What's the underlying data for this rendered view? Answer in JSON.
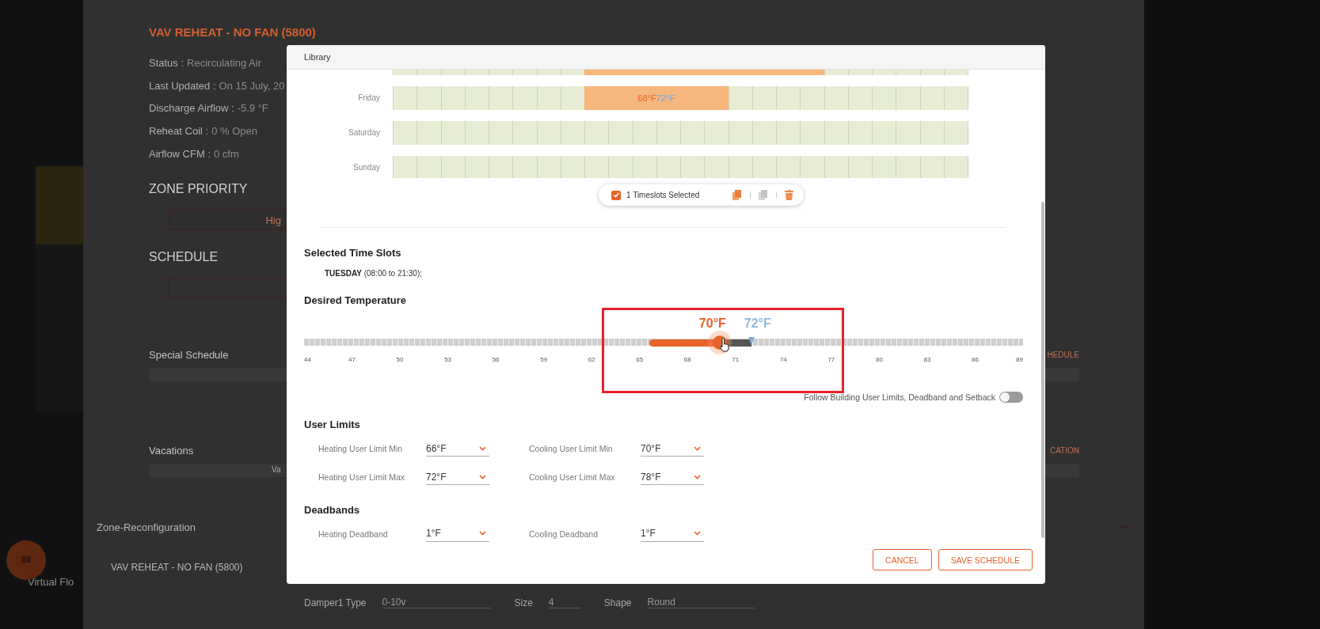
{
  "background_page": {
    "title": "VAV REHEAT - NO FAN (5800)",
    "status": [
      {
        "label": "Status :",
        "value": "Recirculating Air"
      },
      {
        "label": "Last Updated :",
        "value": "On 15 July, 20"
      },
      {
        "label": "Discharge Airflow :",
        "value": "-5.9 °F"
      },
      {
        "label": "Reheat Coil :",
        "value": "0 % Open"
      },
      {
        "label": "Airflow CFM :",
        "value": "0 cfm"
      }
    ],
    "zone_priority": {
      "heading": "ZONE PRIORITY",
      "button": "Hig"
    },
    "schedule": {
      "heading": "SCHEDULE"
    },
    "special_schedule": {
      "heading": "Special Schedule",
      "action": "HEDULE"
    },
    "vacations": {
      "heading": "Vacations",
      "bar_text": "Va",
      "action": "CATION"
    },
    "zone_reconfiguration": {
      "heading": "Zone-Reconfiguration",
      "subheading": "VAV REHEAT - NO FAN (5800)"
    },
    "damper": [
      {
        "label": "Damper1 Type",
        "value": "0-10v"
      },
      {
        "label": "Size",
        "value": "4"
      },
      {
        "label": "Shape",
        "value": "Round"
      }
    ],
    "sidebar_text": "Virtual Flo"
  },
  "modal": {
    "title": "Library",
    "calendar": [
      {
        "cells": [
          {
            "filled": false
          },
          {
            "filled": false
          },
          {
            "filled": false
          },
          {
            "filled": false
          },
          {
            "filled": false
          },
          {
            "filled": false
          },
          {
            "filled": false
          },
          {
            "filled": false
          },
          {
            "filled": true
          },
          {
            "filled": true
          },
          {
            "filled": true
          },
          {
            "filled": true
          },
          {
            "filled": true
          },
          {
            "filled": true
          },
          {
            "filled": true
          },
          {
            "filled": true
          },
          {
            "filled": true
          },
          {
            "filled": true
          },
          {
            "filled": false
          },
          {
            "filled": false
          },
          {
            "filled": false
          },
          {
            "filled": false
          },
          {
            "filled": false
          },
          {
            "filled": false
          }
        ]
      },
      {
        "day": "Friday",
        "heating": "68°F",
        "cooling": "72°F",
        "cells": [
          {
            "filled": false
          },
          {
            "filled": false
          },
          {
            "filled": false
          },
          {
            "filled": false
          },
          {
            "filled": false
          },
          {
            "filled": false
          },
          {
            "filled": false
          },
          {
            "filled": false
          },
          {
            "filled": true
          },
          {
            "filled": true
          },
          {
            "filled": true
          },
          {
            "filled": true
          },
          {
            "filled": true
          },
          {
            "filled": true
          },
          {
            "filled": false
          },
          {
            "filled": false
          },
          {
            "filled": false
          },
          {
            "filled": false
          },
          {
            "filled": false
          },
          {
            "filled": false
          },
          {
            "filled": false
          },
          {
            "filled": false
          },
          {
            "filled": false
          },
          {
            "filled": false
          }
        ]
      },
      {
        "day": "Saturday",
        "cells": [
          {
            "filled": false
          },
          {
            "filled": false
          },
          {
            "filled": false
          },
          {
            "filled": false
          },
          {
            "filled": false
          },
          {
            "filled": false
          },
          {
            "filled": false
          },
          {
            "filled": false
          },
          {
            "filled": false
          },
          {
            "filled": false
          },
          {
            "filled": false
          },
          {
            "filled": false
          },
          {
            "filled": false
          },
          {
            "filled": false
          },
          {
            "filled": false
          },
          {
            "filled": false
          },
          {
            "filled": false
          },
          {
            "filled": false
          },
          {
            "filled": false
          },
          {
            "filled": false
          },
          {
            "filled": false
          },
          {
            "filled": false
          },
          {
            "filled": false
          },
          {
            "filled": false
          }
        ]
      },
      {
        "day": "Sunday",
        "cells": [
          {
            "filled": false
          },
          {
            "filled": false
          },
          {
            "filled": false
          },
          {
            "filled": false
          },
          {
            "filled": false
          },
          {
            "filled": false
          },
          {
            "filled": false
          },
          {
            "filled": false
          },
          {
            "filled": false
          },
          {
            "filled": false
          },
          {
            "filled": false
          },
          {
            "filled": false
          },
          {
            "filled": false
          },
          {
            "filled": false
          },
          {
            "filled": false
          },
          {
            "filled": false
          },
          {
            "filled": false
          },
          {
            "filled": false
          },
          {
            "filled": false
          },
          {
            "filled": false
          },
          {
            "filled": false
          },
          {
            "filled": false
          },
          {
            "filled": false
          },
          {
            "filled": false
          }
        ]
      }
    ],
    "selection": {
      "checked": true,
      "label": "1 Timeslots Selected"
    },
    "selected_heading": "Selected Time Slots",
    "selected_slots": [
      {
        "day": "TUESDAY",
        "range": "(08:00 to 21:30);"
      }
    ],
    "desired_heading": "Desired Temperature",
    "slider": {
      "lower_limit": {
        "level": 0.48
      },
      "heating": {
        "reading": "70°F",
        "level": 0.578
      },
      "cooling": {
        "reading": "72°F",
        "level": 0.622
      },
      "scale": [
        "44",
        "47",
        "50",
        "53",
        "56",
        "59",
        "62",
        "65",
        "68",
        "71",
        "74",
        "77",
        "80",
        "83",
        "86",
        "89"
      ]
    },
    "follow_building": {
      "label": "Follow Building User Limits, Deadband and Setback",
      "on": false
    },
    "sections": [
      {
        "heading": "User Limits",
        "rows": [
          [
            {
              "label": "Heating User Limit Min",
              "value": "66°F"
            },
            {
              "label": "Cooling User Limit Min",
              "value": "70°F"
            }
          ],
          [
            {
              "label": "Heating User Limit Max",
              "value": "72°F"
            },
            {
              "label": "Cooling User Limit Max",
              "value": "78°F"
            }
          ]
        ]
      },
      {
        "heading": "Deadbands",
        "rows": [
          [
            {
              "label": "Heating Deadband",
              "value": "1°F"
            },
            {
              "label": "Cooling Deadband",
              "value": "1°F"
            }
          ]
        ]
      }
    ],
    "buttons": [
      "CANCEL",
      "SAVE SCHEDULE"
    ]
  }
}
